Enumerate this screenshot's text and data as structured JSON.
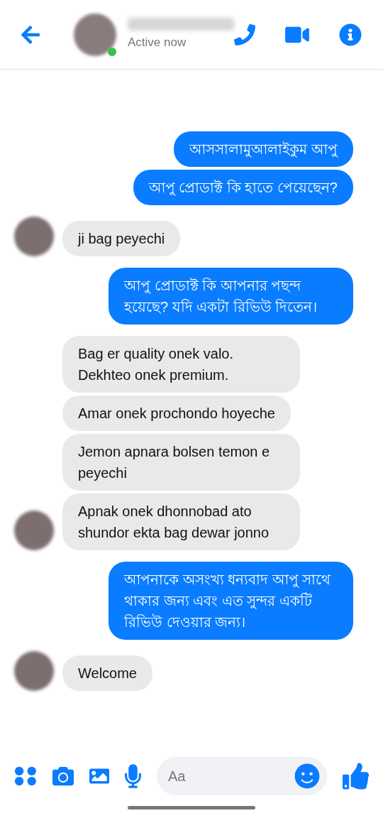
{
  "header": {
    "status": "Active now",
    "online": true
  },
  "messages": [
    {
      "kind": "sent",
      "text": "আসসালামুআলাইকুম আপু",
      "avatar": false
    },
    {
      "kind": "sent",
      "text": "আপু প্রোডাক্ট কি হাতে পেয়েছেন?",
      "avatar": false
    },
    {
      "kind": "received",
      "text": "ji bag peyechi",
      "avatar": true
    },
    {
      "kind": "sent",
      "text": "আপু প্রোডাক্ট কি আপনার পছন্দ হয়েছে? যদি একটা রিভিউ দিতেন।",
      "avatar": false
    },
    {
      "kind": "received",
      "text": "Bag er quality onek valo. Dekhteo onek premium.",
      "avatar": false
    },
    {
      "kind": "received",
      "text": "Amar onek prochondo hoyeche",
      "avatar": false
    },
    {
      "kind": "received",
      "text": "Jemon apnara bolsen temon e peyechi",
      "avatar": false
    },
    {
      "kind": "received",
      "text": "Apnak onek dhonnobad ato shundor ekta bag dewar jonno",
      "avatar": true
    },
    {
      "kind": "sent",
      "text": "আপনাকে অসংখ্য ধন্যবাদ আপু সাথে থাকার জন্য এবং এত সুন্দর একটি রিভিউ দেওয়ার জন্য।",
      "avatar": false
    },
    {
      "kind": "received",
      "text": "Welcome",
      "avatar": true
    }
  ],
  "composer": {
    "placeholder": "Aa"
  }
}
